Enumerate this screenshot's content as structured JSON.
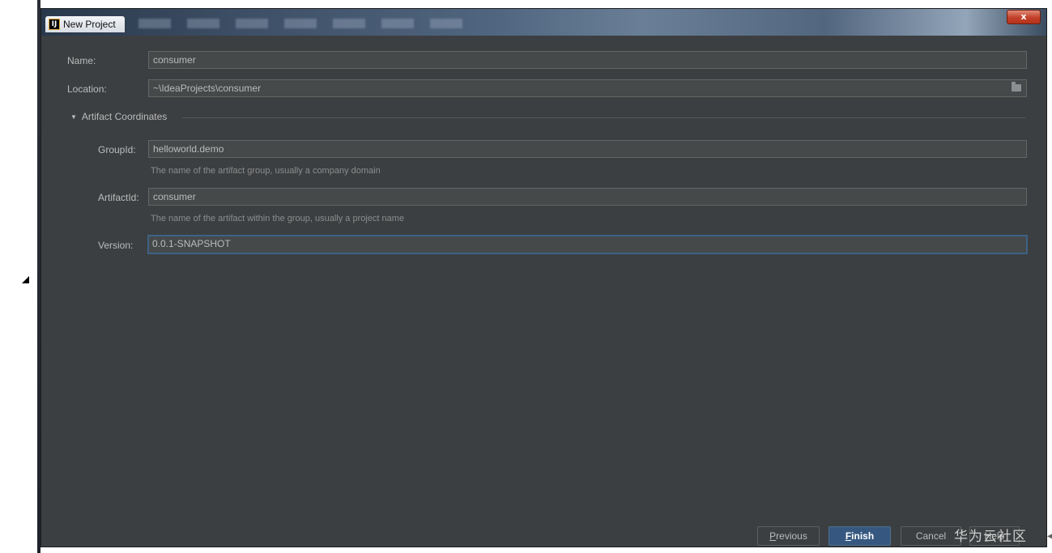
{
  "window": {
    "title": "New Project",
    "app_icon": "IJ",
    "close_symbol": "x"
  },
  "form": {
    "name_label": "Name:",
    "name_value": "consumer",
    "location_label": "Location:",
    "location_value": "~\\IdeaProjects\\consumer",
    "section_title": "Artifact Coordinates",
    "groupid_label": "GroupId:",
    "groupid_value": "helloworld.demo",
    "groupid_hint": "The name of the artifact group, usually a company domain",
    "artifactid_label": "ArtifactId:",
    "artifactid_value": "consumer",
    "artifactid_hint": "The name of the artifact within the group, usually a project name",
    "version_label": "Version:",
    "version_value": "0.0.1-SNAPSHOT"
  },
  "buttons": {
    "previous_mn": "P",
    "previous_rest": "revious",
    "finish_mn": "F",
    "finish_rest": "inish",
    "cancel": "Cancel",
    "help": "Help"
  },
  "watermark": "华为云社区",
  "icons": [
    "folder-icon",
    "triangle-down-icon",
    "close-icon",
    "intellij-app-icon"
  ],
  "colors": {
    "dialog_bg": "#3c3f41",
    "field_bg": "#45494a",
    "focus_border": "#3d6185",
    "primary_button": "#365880"
  }
}
